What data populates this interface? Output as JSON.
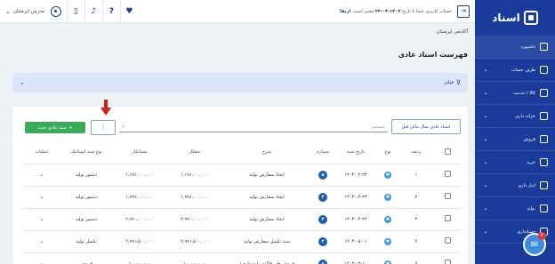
{
  "app": {
    "logo_text": "اسناد"
  },
  "header": {
    "school_name": "مدرس ایرمنتان",
    "account_prefix": "حساب کاربری شما تا تاریخ",
    "account_date": "۱۴۰۳-۰۴-۲۳",
    "account_suffix": "معتبر است.",
    "upgrade_label": "ارتقا"
  },
  "sidebar": {
    "items": [
      {
        "label": "داشبورد",
        "icon": "dashboard-icon"
      },
      {
        "label": "طرف حساب",
        "icon": "users-icon"
      },
      {
        "label": "کالا / خدمت",
        "icon": "box-icon"
      },
      {
        "label": "خزانه داری",
        "icon": "safe-icon"
      },
      {
        "label": "فروش",
        "icon": "sales-icon"
      },
      {
        "label": "خرید",
        "icon": "purchase-icon"
      },
      {
        "label": "انبار داری",
        "icon": "warehouse-icon"
      },
      {
        "label": "تولید",
        "icon": "production-icon"
      },
      {
        "label": "حسابداری",
        "icon": "accounting-icon"
      }
    ]
  },
  "breadcrumb": "آکادمی ایرمنتان",
  "page_title": "فهرست اسناد عادی",
  "filter_label": "فیلتر",
  "toolbar": {
    "new_button": "سند عادی جدید",
    "more_label": "⋮",
    "search_placeholder": "جستجو",
    "prev_year_button": "اسناد عادی سال مالی قبل"
  },
  "table": {
    "headers": {
      "row_no": "ردیف",
      "type": "نوع",
      "date": "تاریخ سند",
      "number": "شماره",
      "description": "شرح",
      "debit": "بدهکار",
      "credit": "بستانکار",
      "auto_type": "نوع سند اتوماتیک",
      "actions": "عملیات"
    },
    "rows": [
      {
        "row_no": "۱",
        "date": "۱۴۰۳-۰۴-۲۳",
        "number": "۵",
        "description": "ایجاد سفارش تولید",
        "debit": "۱,۱۹۶,۰۰۰,۰۰۰",
        "credit": "۱,۱۹۶,۰۰۰,۰۰۰",
        "auto_type": "دستور تولید"
      },
      {
        "row_no": "۲",
        "date": "۱۴۰۳-۰۴-۲۳",
        "number": "۴",
        "description": "ایجاد سفارش تولید",
        "debit": "۱,۷۹۶,۰۰۰,۰۰۰",
        "credit": "۱,۷۹۶,۰۰۰,۰۰۰",
        "auto_type": "دستور تولید"
      },
      {
        "row_no": "۳",
        "date": "۱۴۰۳-۰۴-۲۳",
        "number": "۴",
        "description": "ایجاد سفارش تولید",
        "debit": "۲,۹۹۰,۰۰۰,۰۰۰",
        "credit": "۲,۹۹۰,۰۰۰,۰۰۰",
        "auto_type": "دستور تولید"
      },
      {
        "row_no": "۴",
        "date": "۱۴۰۳-۰۵-۰۱",
        "number": "۳",
        "description": "سند تکمیل سفارش تولید",
        "debit": "۲,۹۹۱,۵۰۰,۰۰۰",
        "credit": "۲,۹۹۱,۵۰۰,۰۰۰",
        "auto_type": "تکمیل تولید"
      },
      {
        "row_no": "۵",
        "date": "۱۴۰۳-۰۴-۱۰",
        "number": "۵",
        "description": "فروش طی فاکتور با شماره ۱",
        "debit": "۱۰,۰۰۰,۰۰۰",
        "credit": "۱۰,۰۰۰,۰۰۰",
        "auto_type": "فروش"
      }
    ]
  },
  "chat": {
    "badge": "۴"
  },
  "colors": {
    "primary": "#1a3b9c",
    "success": "#3aab58",
    "filter_bg": "#dbe6f8",
    "arrow": "#d81e1e"
  }
}
